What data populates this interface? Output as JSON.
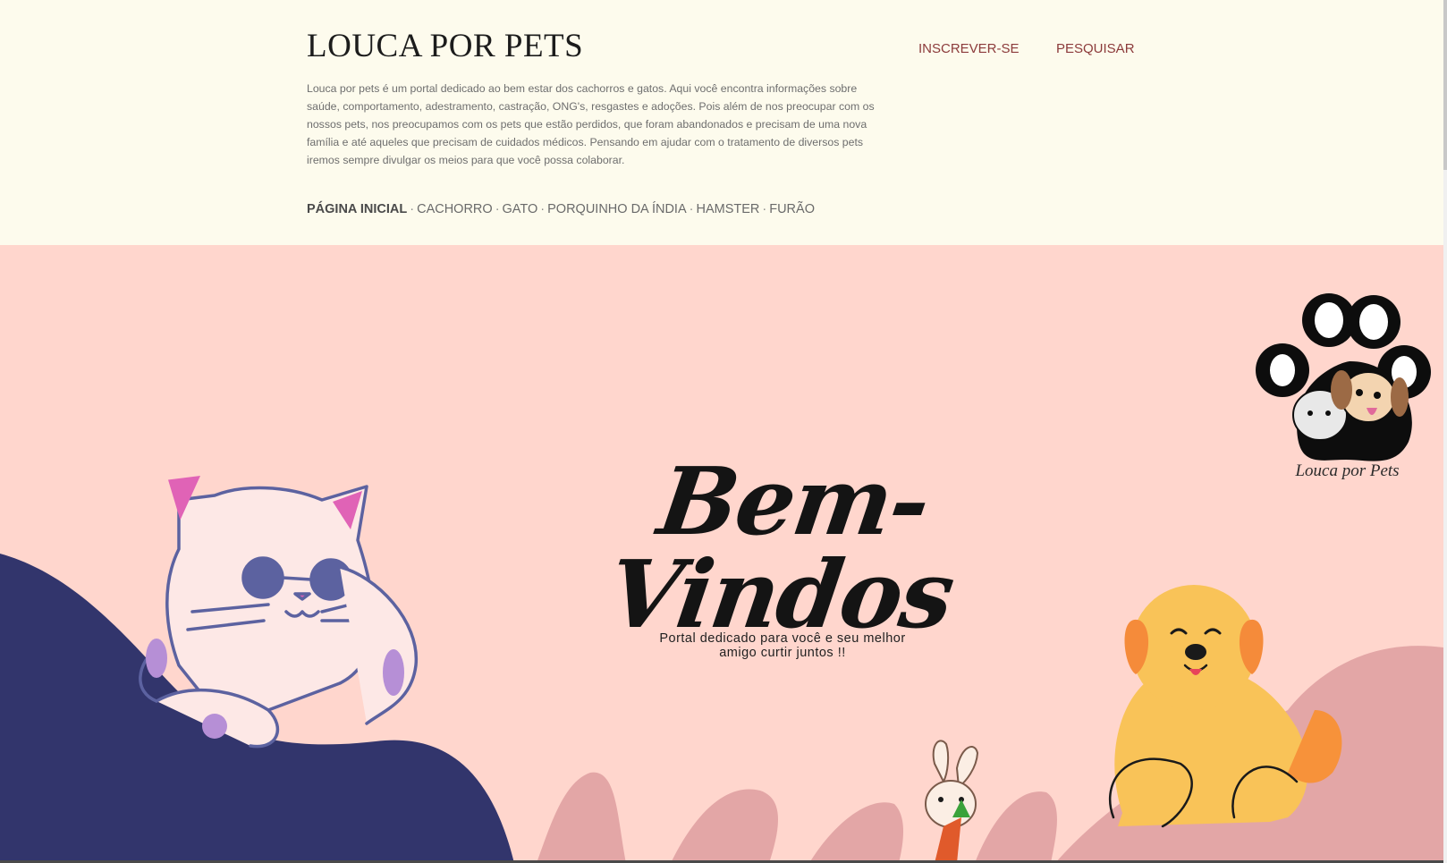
{
  "header": {
    "site_title": "LOUCA POR PETS",
    "links": {
      "subscribe": "INSCREVER-SE",
      "search": "PESQUISAR"
    },
    "description": "Louca por pets é um portal dedicado ao bem estar dos cachorros e gatos. Aqui você encontra informações sobre saúde, comportamento, adestramento, castração, ONG's, resgastes e adoções. Pois além de nos preocupar com os nossos pets, nos preocupamos com os pets que estão perdidos, que foram abandonados e precisam de uma nova família e até aqueles que precisam de cuidados médicos. Pensando em ajudar com o tratamento de diversos pets iremos sempre divulgar os meios para que você possa colaborar."
  },
  "nav": {
    "items": [
      {
        "label": "PÁGINA INICIAL",
        "active": true
      },
      {
        "label": "CACHORRO",
        "active": false
      },
      {
        "label": "GATO",
        "active": false
      },
      {
        "label": "PORQUINHO DA ÍNDIA",
        "active": false
      },
      {
        "label": "HAMSTER",
        "active": false
      },
      {
        "label": "FURÃO",
        "active": false
      }
    ],
    "separator": "·"
  },
  "hero": {
    "headline": "Bem-Vindos",
    "tagline_line1": "Portal dedicado para você e seu melhor",
    "tagline_line2": "amigo curtir juntos !!",
    "logo_caption": "Louca por Pets",
    "colors": {
      "background": "#ffd6cd",
      "navy_wave": "#32356c",
      "mauve_shapes": "#e3a6a6",
      "cat_outline": "#5c62a0",
      "dog_body": "#f9c358"
    }
  }
}
